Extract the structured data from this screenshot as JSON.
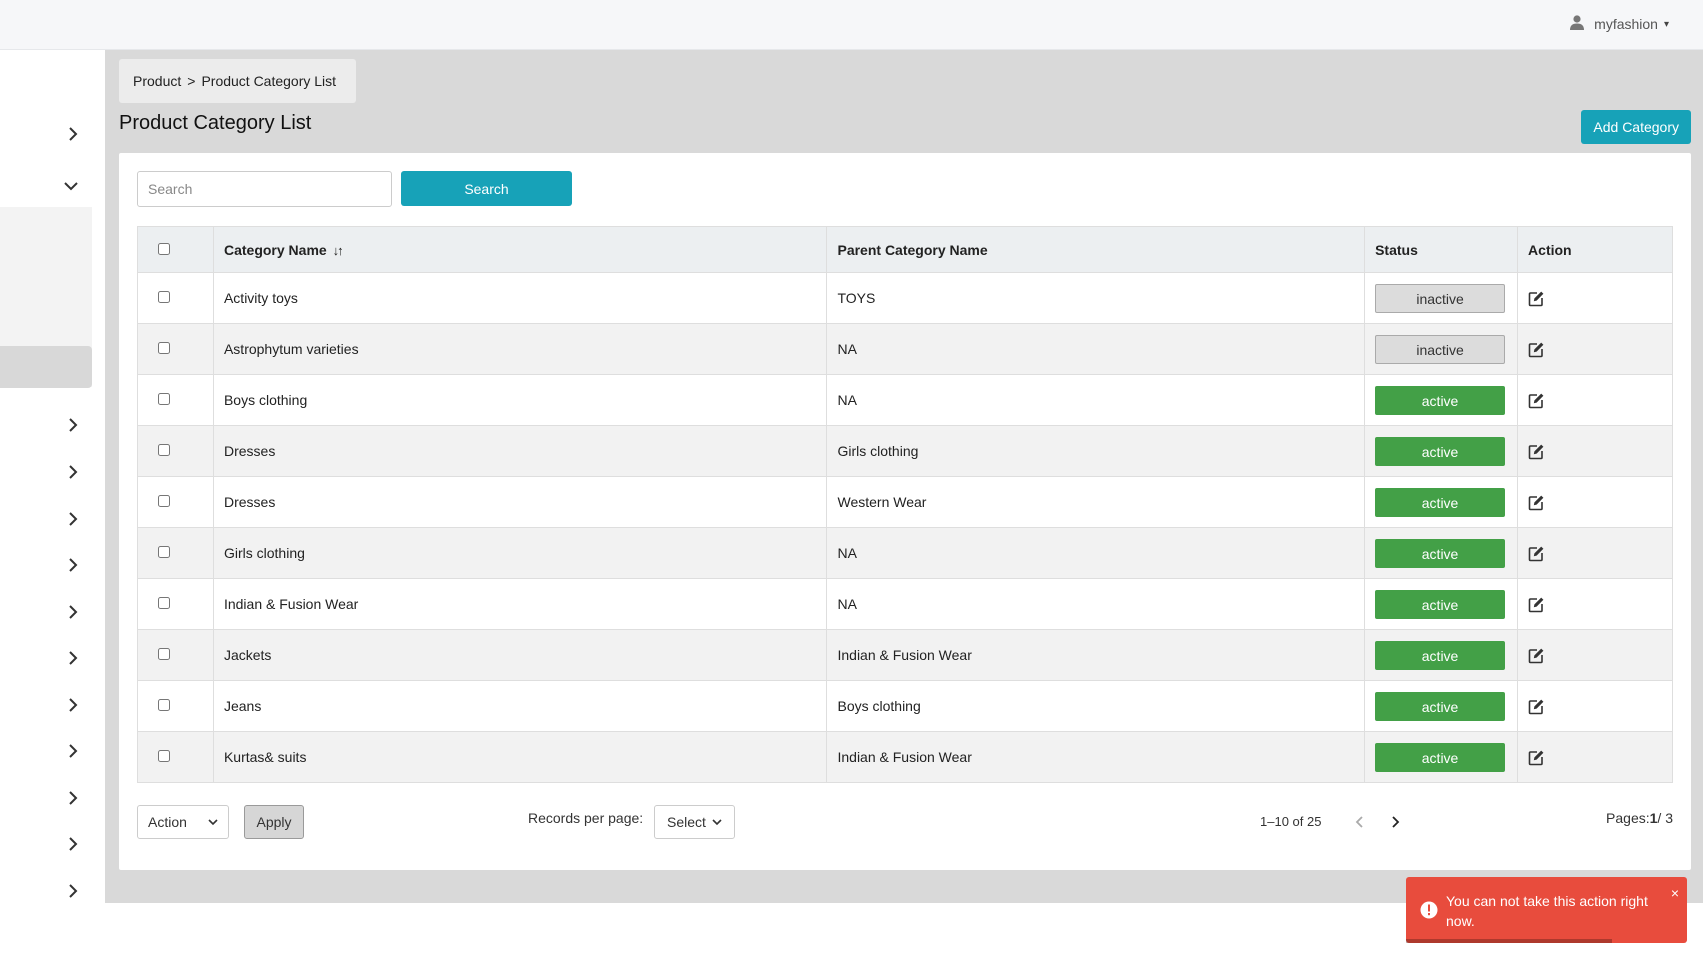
{
  "header": {
    "username": "myfashion"
  },
  "breadcrumb": {
    "root": "Product",
    "separator": ">",
    "current": "Product Category List"
  },
  "page": {
    "title": "Product Category List",
    "add_label": "Add Category"
  },
  "search": {
    "placeholder": "Search",
    "button_label": "Search"
  },
  "table": {
    "columns": {
      "name": "Category Name",
      "parent": "Parent Category Name",
      "status": "Status",
      "action": "Action"
    },
    "rows": [
      {
        "name": "Activity toys",
        "parent": "TOYS",
        "status": "inactive"
      },
      {
        "name": "Astrophytum varieties",
        "parent": "NA",
        "status": "inactive"
      },
      {
        "name": "Boys clothing",
        "parent": "NA",
        "status": "active"
      },
      {
        "name": "Dresses",
        "parent": "Girls clothing",
        "status": "active"
      },
      {
        "name": "Dresses",
        "parent": "Western Wear",
        "status": "active"
      },
      {
        "name": "Girls clothing",
        "parent": "NA",
        "status": "active"
      },
      {
        "name": "Indian & Fusion Wear",
        "parent": "NA",
        "status": "active"
      },
      {
        "name": "Jackets",
        "parent": "Indian & Fusion Wear",
        "status": "active"
      },
      {
        "name": "Jeans",
        "parent": "Boys clothing",
        "status": "active"
      },
      {
        "name": "Kurtas& suits",
        "parent": "Indian & Fusion Wear",
        "status": "active"
      }
    ]
  },
  "footer": {
    "action_select": "Action",
    "apply_label": "Apply",
    "records_label": "Records per page:",
    "records_select": "Select",
    "range": "1–10 of 25",
    "pages_label": "Pages:",
    "current_page": "1",
    "total_pages": "/ 3"
  },
  "toast": {
    "message": "You can not take this action right now.",
    "close": "×"
  },
  "colors": {
    "accent": "#17a2b8",
    "active": "#43a047",
    "inactive": "#dcdcdc",
    "toast": "#e84c3d"
  }
}
